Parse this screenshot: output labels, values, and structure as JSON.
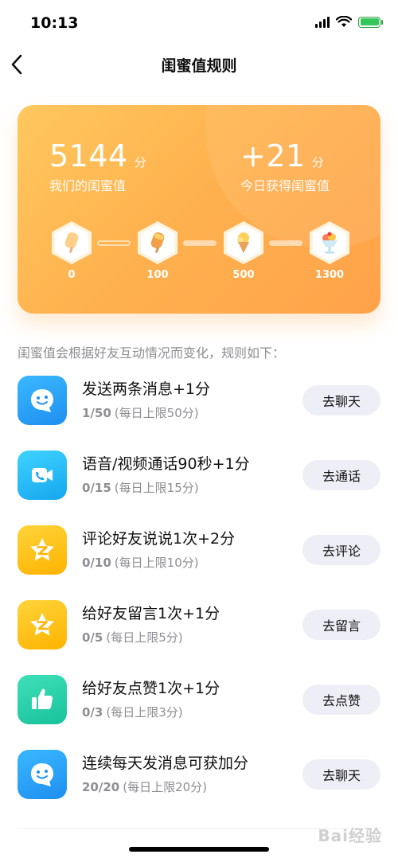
{
  "status_bar": {
    "time": "10:13"
  },
  "nav": {
    "title": "闺蜜值规则"
  },
  "summary": {
    "total_value": "5144",
    "total_unit": "分",
    "total_label": "我们的闺蜜值",
    "today_value": "+21",
    "today_unit": "分",
    "today_label": "今日获得闺蜜值",
    "milestones": [
      {
        "label": "0",
        "icon": "popsicle-icon"
      },
      {
        "label": "100",
        "icon": "ice-pop-icon"
      },
      {
        "label": "500",
        "icon": "ice-cream-cone-icon"
      },
      {
        "label": "1300",
        "icon": "sundae-icon"
      }
    ]
  },
  "rules_intro": "闺蜜值会根据好友互动情况而变化，规则如下：",
  "rules": [
    {
      "title": "发送两条消息+1分",
      "progress": "1/50",
      "limit": "(每日上限50分)",
      "button": "去聊天",
      "icon": "chat-icon",
      "color": "#2fa8f5"
    },
    {
      "title": "语音/视频通话90秒+1分",
      "progress": "0/15",
      "limit": "(每日上限15分)",
      "button": "去通话",
      "icon": "video-call-icon",
      "color": "#22c1f2"
    },
    {
      "title": "评论好友说说1次+2分",
      "progress": "0/10",
      "limit": "(每日上限10分)",
      "button": "去评论",
      "icon": "qzone-star-icon",
      "color": "#ffc21f"
    },
    {
      "title": "给好友留言1次+1分",
      "progress": "0/5",
      "limit": "(每日上限5分)",
      "button": "去留言",
      "icon": "qzone-star-icon",
      "color": "#ffc21f"
    },
    {
      "title": "给好友点赞1次+1分",
      "progress": "0/3",
      "limit": "(每日上限3分)",
      "button": "去点赞",
      "icon": "thumbs-up-icon",
      "color": "#2cd6b0"
    },
    {
      "title": "连续每天发消息可获加分",
      "progress": "20/20",
      "limit": "(每日上限20分)",
      "button": "去聊天",
      "icon": "chat-icon",
      "color": "#2fa8f5"
    }
  ],
  "watermark": "Bai经验"
}
